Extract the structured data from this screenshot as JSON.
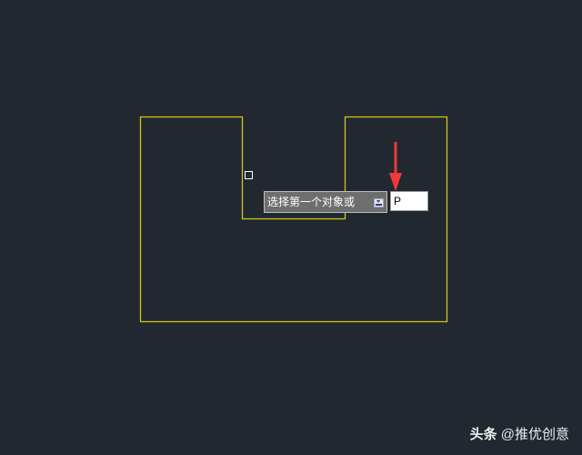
{
  "prompt": {
    "text": "选择第一个对象或",
    "dropdown_icon": "dropdown-arrow-icon"
  },
  "command_input": {
    "value": "P"
  },
  "watermark": {
    "brand": "头条",
    "author": "@推优创意"
  },
  "colors": {
    "background": "#212830",
    "drawing_lines": "#d4c31c",
    "arrow": "#f03a3a",
    "tooltip_bg": "#6e6e6e",
    "pickbox": "#ffffff"
  }
}
